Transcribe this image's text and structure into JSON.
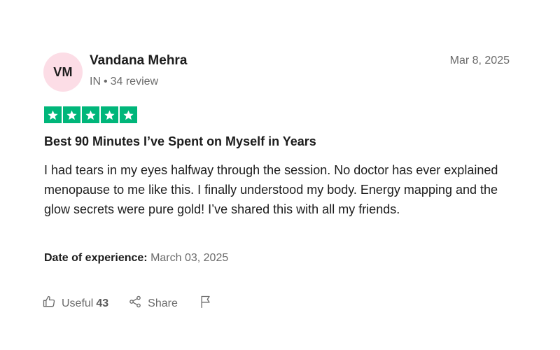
{
  "reviewer": {
    "initials": "VM",
    "name": "Vandana Mehra",
    "country": "IN",
    "separator": "•",
    "review_count": "34 review",
    "avatar_color": "#fcdde6"
  },
  "review": {
    "date": "Mar 8, 2025",
    "rating": 5,
    "rating_color": "#00b67a",
    "title": "Best 90 Minutes I’ve Spent on Myself in Years",
    "body": "I had tears in my eyes halfway through the session. No doctor has ever explained menopause to me like this. I finally understood my body. Energy mapping and the glow secrets were pure gold! I’ve shared this with all my friends.",
    "experience_label": "Date of experience:",
    "experience_date": "March 03, 2025"
  },
  "actions": {
    "useful_label": "Useful",
    "useful_count": "43",
    "useful_icon": "thumbs-up-icon",
    "share_label": "Share",
    "share_icon": "share-icon",
    "report_icon": "flag-icon"
  }
}
